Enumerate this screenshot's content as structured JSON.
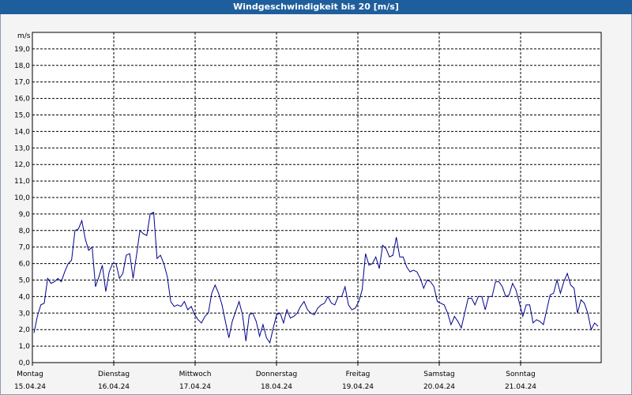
{
  "window": {
    "title": "Windgeschwindigkeit bis 20 [m/s]"
  },
  "chart_data": {
    "type": "line",
    "title": "Windgeschwindigkeit bis 20 [m/s]",
    "ylabel": "m/s",
    "ylim": [
      0,
      20
    ],
    "yticks": [
      "0,0",
      "1,0",
      "2,0",
      "3,0",
      "4,0",
      "5,0",
      "6,0",
      "7,0",
      "8,0",
      "9,0",
      "10,0",
      "11,0",
      "12,0",
      "13,0",
      "14,0",
      "15,0",
      "16,0",
      "17,0",
      "18,0",
      "19,0"
    ],
    "days": [
      {
        "name": "Montag",
        "date": "15.04.24"
      },
      {
        "name": "Dienstag",
        "date": "16.04.24"
      },
      {
        "name": "Mittwoch",
        "date": "17.04.24"
      },
      {
        "name": "Donnerstag",
        "date": "18.04.24"
      },
      {
        "name": "Freitag",
        "date": "19.04.24"
      },
      {
        "name": "Samstag",
        "date": "20.04.24"
      },
      {
        "name": "Sonntag",
        "date": "21.04.24"
      }
    ],
    "grid": true,
    "line_color": "#00008b",
    "series": [
      {
        "values": [
          1.8,
          2.8,
          3.5,
          3.6,
          5.1,
          4.8,
          4.9,
          5.1,
          4.9,
          5.5,
          6.0,
          6.2,
          8.0,
          8.1,
          8.6,
          7.5,
          6.8,
          7.0,
          4.6,
          5.2,
          5.9,
          4.3,
          5.5,
          6.0,
          6.0,
          5.1,
          5.4,
          6.5,
          6.6,
          5.1,
          6.5,
          8.0,
          7.8,
          7.7,
          9.0,
          9.1,
          6.3,
          6.5,
          6.0,
          5.2,
          3.7,
          3.4,
          3.5,
          3.4,
          3.7,
          3.2,
          3.4,
          2.9,
          2.6,
          2.4,
          2.8,
          3.0,
          4.2,
          4.7,
          4.2,
          3.5,
          2.5,
          1.5,
          2.5,
          3.1,
          3.7,
          2.9,
          1.3,
          2.9,
          3.0,
          2.5,
          1.6,
          2.3,
          1.5,
          1.2,
          2.1,
          2.9,
          3.0,
          2.4,
          3.2,
          2.7,
          2.8,
          3.0,
          3.4,
          3.7,
          3.2,
          3.0,
          2.9,
          3.3,
          3.5,
          3.6,
          4.0,
          3.6,
          3.5,
          4.0,
          4.0,
          4.6,
          3.5,
          3.2,
          3.3,
          3.7,
          4.4,
          6.6,
          5.9,
          6.0,
          6.4,
          5.7,
          7.1,
          6.9,
          6.4,
          6.5,
          7.6,
          6.4,
          6.4,
          5.8,
          5.5,
          5.6,
          5.5,
          5.1,
          4.5,
          5.0,
          4.9,
          4.6,
          3.7,
          3.6,
          3.5,
          3.0,
          2.3,
          2.8,
          2.5,
          2.1,
          3.0,
          3.9,
          3.9,
          3.5,
          4.0,
          4.0,
          3.2,
          4.0,
          4.0,
          4.9,
          4.9,
          4.6,
          4.0,
          4.1,
          4.8,
          4.4,
          3.6,
          2.8,
          3.5,
          3.5,
          2.4,
          2.6,
          2.5,
          2.3,
          3.2,
          4.1,
          4.2,
          5.0,
          4.2,
          4.9,
          5.4,
          4.7,
          4.5,
          3.0,
          3.8,
          3.6,
          3.0,
          2.0,
          2.4,
          2.2
        ]
      }
    ]
  }
}
